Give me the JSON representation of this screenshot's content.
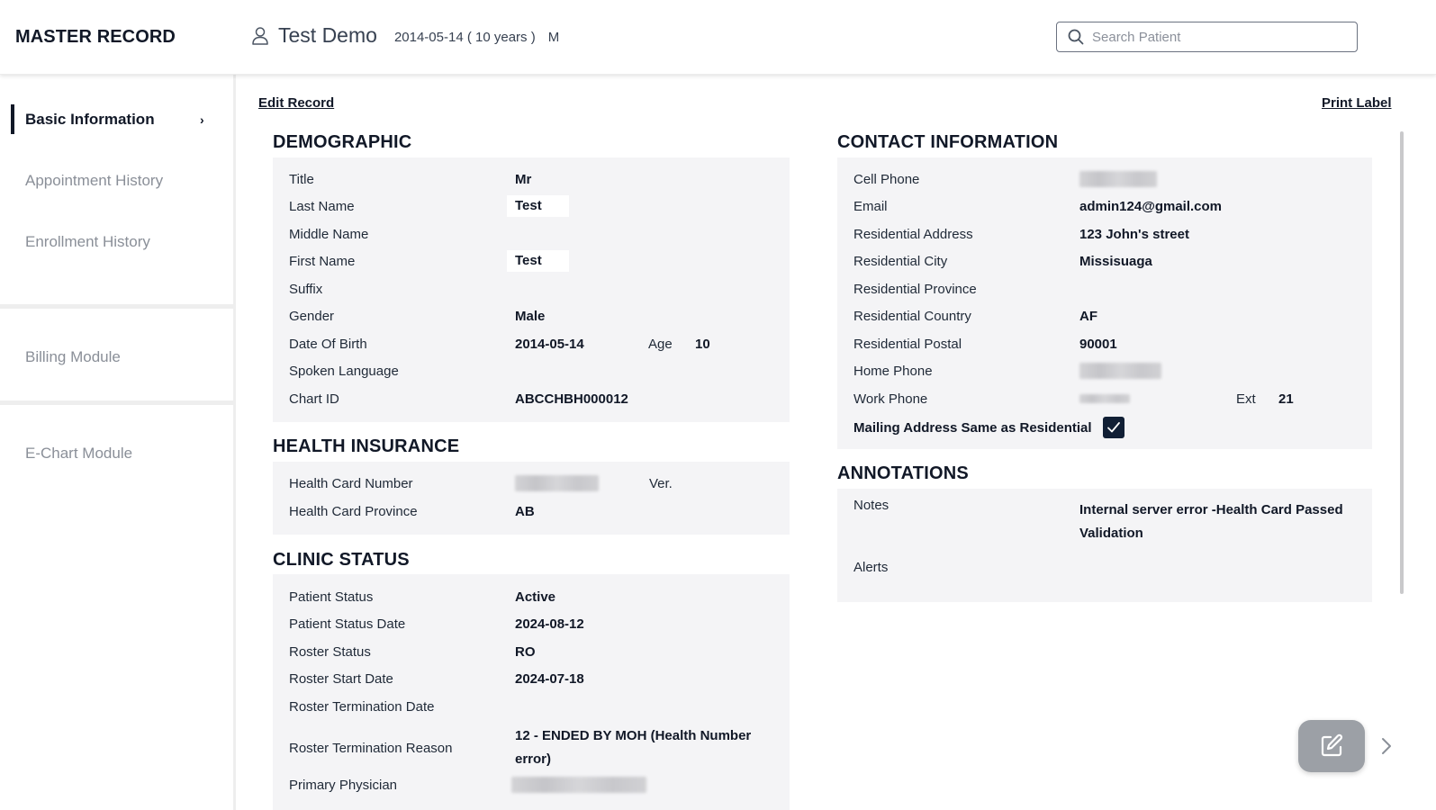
{
  "header": {
    "app_title": "MASTER RECORD",
    "patient_name": "Test Demo",
    "patient_dob_age": "2014-05-14 ( 10 years )",
    "patient_sex": "M",
    "search_placeholder": "Search Patient",
    "search_value": ""
  },
  "sidebar": {
    "items": [
      {
        "label": "Basic Information",
        "active": true
      },
      {
        "label": "Appointment History",
        "active": false
      },
      {
        "label": "Enrollment History",
        "active": false
      },
      {
        "label": "Billing Module",
        "active": false
      },
      {
        "label": "E-Chart Module",
        "active": false
      }
    ],
    "active_chevron": "›"
  },
  "actions": {
    "edit_record": "Edit Record",
    "print_label": "Print Label"
  },
  "demographic": {
    "title": "DEMOGRAPHIC",
    "rows": [
      {
        "label": "Title",
        "value": "Mr"
      },
      {
        "label": "Last Name",
        "value": "Test"
      },
      {
        "label": "Middle Name",
        "value": ""
      },
      {
        "label": "First Name",
        "value": "Test"
      },
      {
        "label": "Suffix",
        "value": ""
      },
      {
        "label": "Gender",
        "value": "Male"
      },
      {
        "label": "Date Of Birth",
        "value": "2014-05-14"
      },
      {
        "label": "Spoken Language",
        "value": ""
      },
      {
        "label": "Chart ID",
        "value": "ABCCHBH000012"
      }
    ],
    "age_label": "Age",
    "age_value": "10"
  },
  "health_insurance": {
    "title": "HEALTH INSURANCE",
    "rows": [
      {
        "label": "Health Card Number",
        "value": "[redacted]"
      },
      {
        "label": "Health Card Province",
        "value": "AB"
      }
    ],
    "version_label": "Ver.",
    "version_value": ""
  },
  "clinic_status": {
    "title": "CLINIC STATUS",
    "rows": [
      {
        "label": "Patient Status",
        "value": "Active"
      },
      {
        "label": "Patient Status Date",
        "value": "2024-08-12"
      },
      {
        "label": "Roster Status",
        "value": "RO"
      },
      {
        "label": "Roster Start Date",
        "value": "2024-07-18"
      },
      {
        "label": "Roster Termination Date",
        "value": ""
      },
      {
        "label": "Roster Termination Reason",
        "value_line1": "12 - ENDED BY MOH (Health Number",
        "value_line2": "error)"
      },
      {
        "label": "Primary Physician",
        "value": "[redacted]"
      }
    ]
  },
  "contact": {
    "title": "CONTACT INFORMATION",
    "rows": [
      {
        "label": "Cell Phone",
        "value": "[redacted]"
      },
      {
        "label": "Email",
        "value": "admin124@gmail.com"
      },
      {
        "label": "Residential Address",
        "value": "123 John's street"
      },
      {
        "label": "Residential City",
        "value": "Missisuaga"
      },
      {
        "label": "Residential Province",
        "value": ""
      },
      {
        "label": "Residential Country",
        "value": "AF"
      },
      {
        "label": "Residential Postal",
        "value": "90001"
      },
      {
        "label": "Home Phone",
        "value": "[redacted]"
      },
      {
        "label": "Work Phone",
        "value": "[redacted]"
      }
    ],
    "ext_label": "Ext",
    "ext_value": "21",
    "mailing_same_label": "Mailing Address Same as Residential",
    "mailing_same_checked": true
  },
  "annotations": {
    "title": "ANNOTATIONS",
    "notes_label": "Notes",
    "notes_line1": "Internal server error -Health Card Passed",
    "notes_line2": "Validation",
    "alerts_label": "Alerts",
    "alerts_value": ""
  },
  "icons": {
    "user": "user-icon",
    "search": "search-icon",
    "chevron_right": "chevron-right-icon",
    "check": "check-icon",
    "edit": "edit-icon"
  },
  "colors": {
    "primary_dark": "#111827",
    "panel_bg": "#f4f4f6",
    "muted_text": "#8a8f98",
    "fab_bg": "#9ca0a6"
  }
}
